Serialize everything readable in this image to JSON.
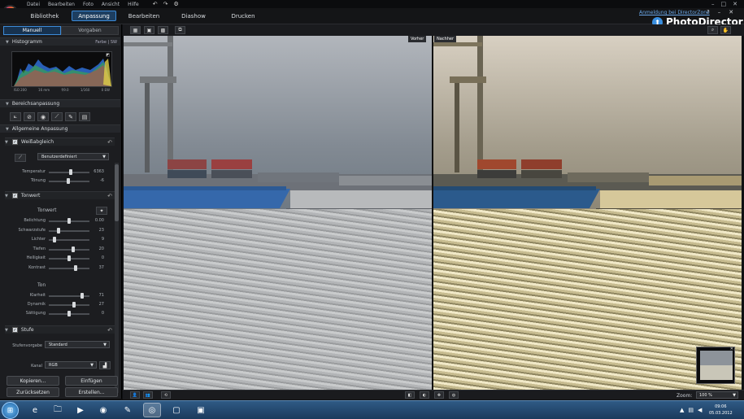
{
  "menu": {
    "items": [
      "Datei",
      "Bearbeiten",
      "Foto",
      "Ansicht",
      "Hilfe"
    ]
  },
  "header": {
    "tabs": [
      {
        "label": "Bibliothek",
        "active": false
      },
      {
        "label": "Anpassung",
        "active": true
      },
      {
        "label": "Bearbeiten",
        "active": false
      },
      {
        "label": "Diashow",
        "active": false
      },
      {
        "label": "Drucken",
        "active": false
      }
    ],
    "directorzone_link": "Anmeldung bei DirectorZone",
    "brand": "PhotoDirector",
    "accent_color": "#3c8bd8"
  },
  "left_panel": {
    "tabs": [
      {
        "label": "Manuell",
        "active": true
      },
      {
        "label": "Vorgaben",
        "active": false
      }
    ],
    "histogram": {
      "title": "Histogramm",
      "mode_color": "Farbe",
      "mode_bw": "SW",
      "info": [
        "ISO 200",
        "16 mm",
        "f/9.0",
        "1/160",
        "0 EW"
      ]
    },
    "region": {
      "title": "Bereichsanpassung"
    },
    "general": {
      "title": "Allgemeine Anpassung"
    },
    "white_balance": {
      "title": "Weißabgleich",
      "preset": "Benutzerdefiniert",
      "sliders": [
        {
          "label": "Temperatur",
          "value": "6363",
          "pos": 0.55
        },
        {
          "label": "Tönung",
          "value": "-6",
          "pos": 0.48
        }
      ]
    },
    "tone": {
      "title": "Tonwert",
      "subtitle": "Tonwert",
      "sliders": [
        {
          "label": "Belichtung",
          "value": "0.00",
          "pos": 0.5
        },
        {
          "label": "Schwarzstufe",
          "value": "23",
          "pos": 0.22
        },
        {
          "label": "Lichter",
          "value": "9",
          "pos": 0.1
        },
        {
          "label": "Tiefen",
          "value": "20",
          "pos": 0.6
        },
        {
          "label": "Helligkeit",
          "value": "0",
          "pos": 0.5
        },
        {
          "label": "Kontrast",
          "value": "37",
          "pos": 0.68
        }
      ],
      "sub2": "Ton",
      "sliders2": [
        {
          "label": "Klarheit",
          "value": "71",
          "pos": 0.85
        },
        {
          "label": "Dynamik",
          "value": "27",
          "pos": 0.63
        },
        {
          "label": "Sättigung",
          "value": "0",
          "pos": 0.5
        }
      ]
    },
    "levels": {
      "title": "Stufe",
      "preset_label": "Stufenvorgabe",
      "preset": "Standard",
      "channel_label": "Kanal",
      "channel": "RGB"
    },
    "buttons": {
      "copy": "Kopieren...",
      "paste": "Einfügen",
      "reset": "Zurücksetzen",
      "create": "Erstellen..."
    }
  },
  "viewer": {
    "before_label": "Vorher",
    "after_label": "Nachher",
    "zoom_label": "Zoom:",
    "zoom_value": "100 %"
  },
  "taskbar": {
    "time": "09:06",
    "date": "05.03.2012"
  }
}
